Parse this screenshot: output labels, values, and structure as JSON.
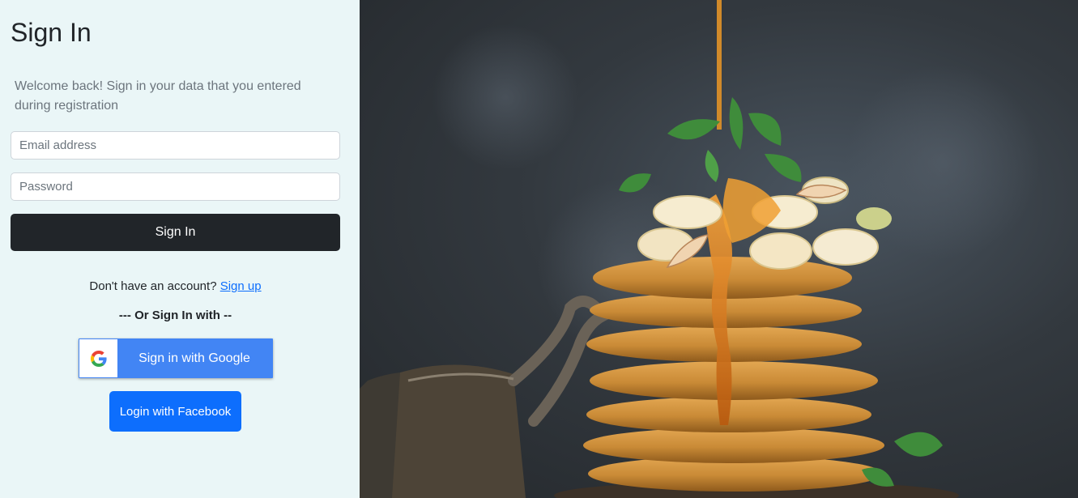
{
  "form": {
    "title": "Sign In",
    "subtitle": "Welcome back! Sign in your data that you entered during registration",
    "email_placeholder": "Email address",
    "password_placeholder": "Password",
    "submit_label": "Sign In",
    "signup_prompt": "Don't have an account?",
    "signup_link": "Sign up",
    "divider_text": "--- Or Sign In with --",
    "google_label": "Sign in with Google",
    "facebook_label": "Login with Facebook"
  },
  "colors": {
    "panel_bg": "#eaf6f7",
    "primary_dark": "#212529",
    "google_blue": "#4285f4",
    "facebook_blue": "#0d6efd",
    "link": "#0d6efd"
  },
  "icons": {
    "google": "google-logo-icon"
  },
  "hero_image": {
    "subject": "stack of pancakes with banana slices, mint and syrup"
  }
}
